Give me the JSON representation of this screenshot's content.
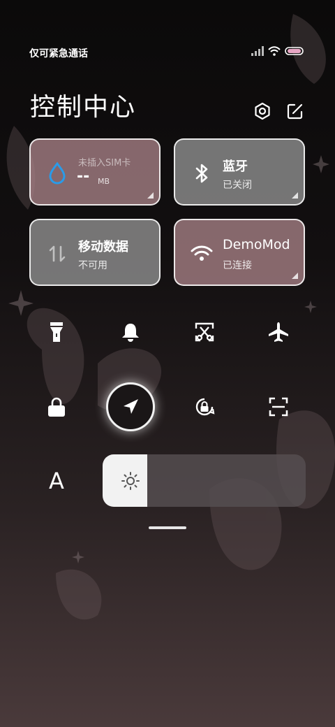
{
  "status_bar": {
    "carrier": "仅可紧急通话",
    "signal_icon": "signal-icon",
    "wifi_icon": "wifi-icon",
    "battery_icon": "battery-icon"
  },
  "header": {
    "title": "控制中心",
    "settings_icon": "settings-icon",
    "edit_icon": "edit-icon"
  },
  "tiles": {
    "data_usage": {
      "label": "未插入SIM卡",
      "value": "--",
      "unit": "MB",
      "icon": "water-drop-icon"
    },
    "bluetooth": {
      "label": "蓝牙",
      "status": "已关闭",
      "icon": "bluetooth-icon"
    },
    "mobile_data": {
      "label": "移动数据",
      "status": "不可用",
      "icon": "mobile-data-icon"
    },
    "wifi": {
      "label": "DemoMod",
      "status": "已连接",
      "icon": "wifi-icon"
    }
  },
  "quick_toggles": [
    {
      "name": "flashlight",
      "icon": "flashlight-icon"
    },
    {
      "name": "silent",
      "icon": "bell-icon"
    },
    {
      "name": "screenshot",
      "icon": "screenshot-icon"
    },
    {
      "name": "airplane",
      "icon": "airplane-icon"
    },
    {
      "name": "lock",
      "icon": "lock-icon"
    },
    {
      "name": "location",
      "icon": "location-arrow-icon"
    },
    {
      "name": "rotation-lock",
      "icon": "rotation-lock-icon"
    },
    {
      "name": "scan",
      "icon": "scan-icon"
    }
  ],
  "font_button": {
    "label": "A"
  },
  "brightness": {
    "level": 0.22,
    "icon": "sun-icon"
  },
  "colors": {
    "tile_pink": "#a88286",
    "tile_gray": "#8c8c8c",
    "accent_blue": "#2a9be8"
  }
}
